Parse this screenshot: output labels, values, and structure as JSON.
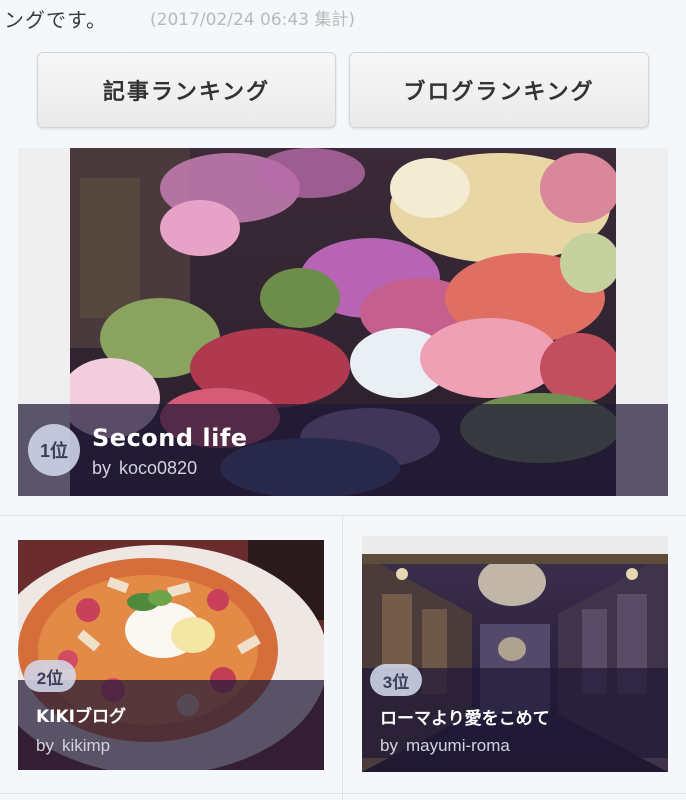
{
  "intro": {
    "lead_text": "ングです。",
    "timestamp": "(2017/02/24 06:43 集計)"
  },
  "tabs": {
    "article_ranking": "記事ランキング",
    "blog_ranking": "ブログランキング"
  },
  "ranking": [
    {
      "rank": "1位",
      "title": "Second life",
      "by": "by",
      "author": "koco0820",
      "photo": "flower-shop-photo"
    },
    {
      "rank": "2位",
      "title": "KIKIブログ",
      "by": "by",
      "author": "kikimp",
      "photo": "pancake-photo"
    },
    {
      "rank": "3位",
      "title": "ローマより愛をこめて",
      "by": "by",
      "author": "mayumi-roma",
      "photo": "hall-of-mirrors-photo"
    }
  ],
  "colors": {
    "overlay": "#201937",
    "badge": "#d2d7eb",
    "button_bg": "#f2f2f2",
    "page_bg": "#f4f8fb"
  }
}
